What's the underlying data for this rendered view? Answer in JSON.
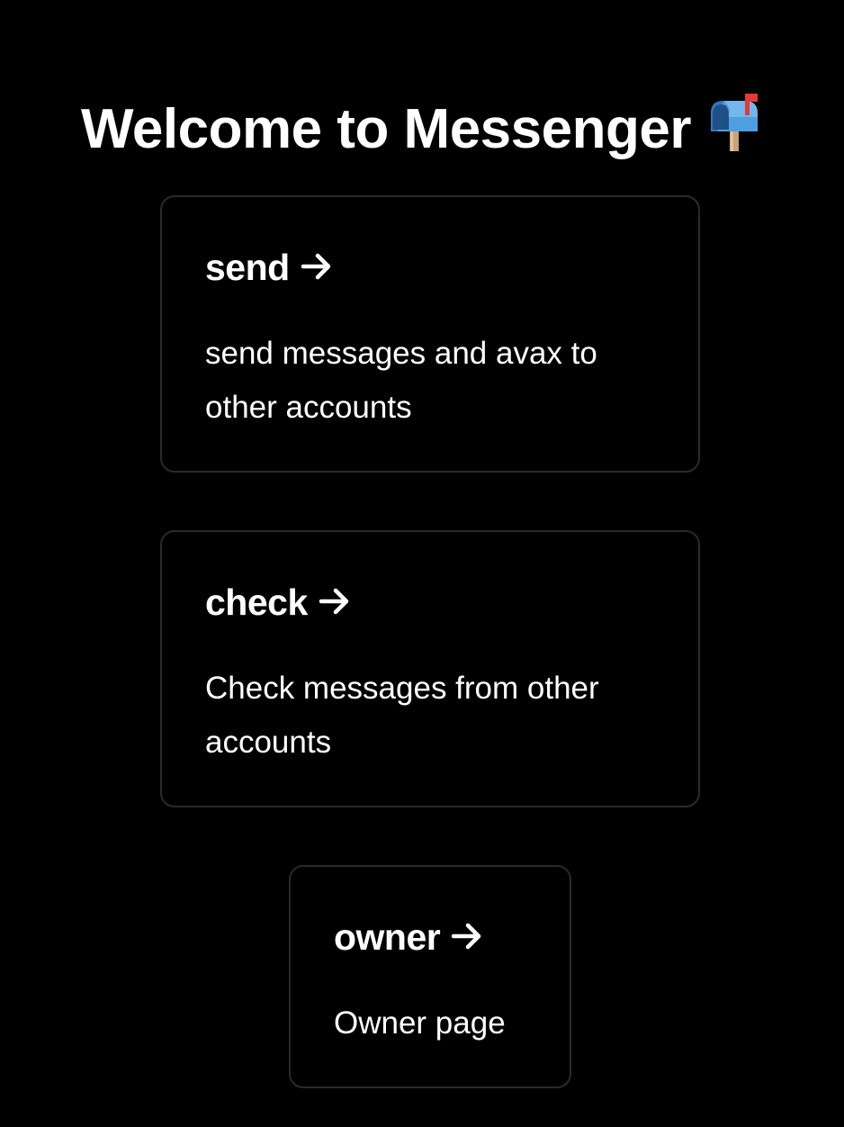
{
  "page": {
    "title": "Welcome to Messenger",
    "title_icon": "mailbox-icon"
  },
  "cards": [
    {
      "title": "send",
      "arrow_icon": "arrow-right-icon",
      "description": "send messages and avax to other accounts"
    },
    {
      "title": "check",
      "arrow_icon": "arrow-right-icon",
      "description": "Check messages from other accounts"
    },
    {
      "title": "owner",
      "arrow_icon": "arrow-right-icon",
      "description": "Owner page"
    }
  ],
  "colors": {
    "background": "#000000",
    "text": "#ffffff",
    "card_border": "#2a2a2a",
    "mailbox_blue": "#5aa9e6",
    "mailbox_flag": "#e53935"
  }
}
